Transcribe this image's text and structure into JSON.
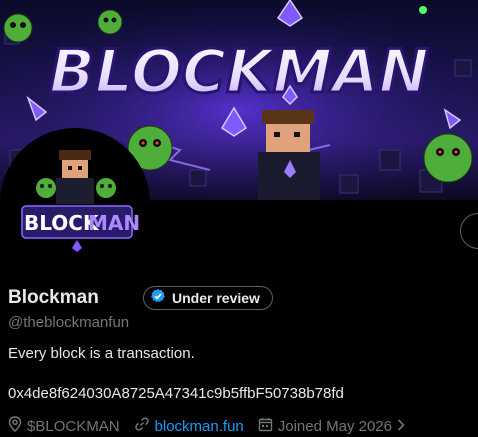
{
  "banner": {
    "title": "BLOCKMAN"
  },
  "avatar": {
    "logo_text_1": "BLOCK",
    "logo_text_2": "MAN"
  },
  "profile": {
    "name": "Blockman",
    "badge_label": "Under review",
    "handle": "@theblockmanfun",
    "bio": "Every block is a transaction.",
    "address": "0x4de8f624030A8725A47341c9b5ffbF50738b78fd"
  },
  "meta": {
    "location": "$BLOCKMAN",
    "website": "blockman.fun",
    "joined": "Joined May 2026"
  },
  "colors": {
    "accent": "#1d9bf0",
    "muted": "#71767b",
    "text": "#e7e9ea",
    "background": "#000000"
  }
}
